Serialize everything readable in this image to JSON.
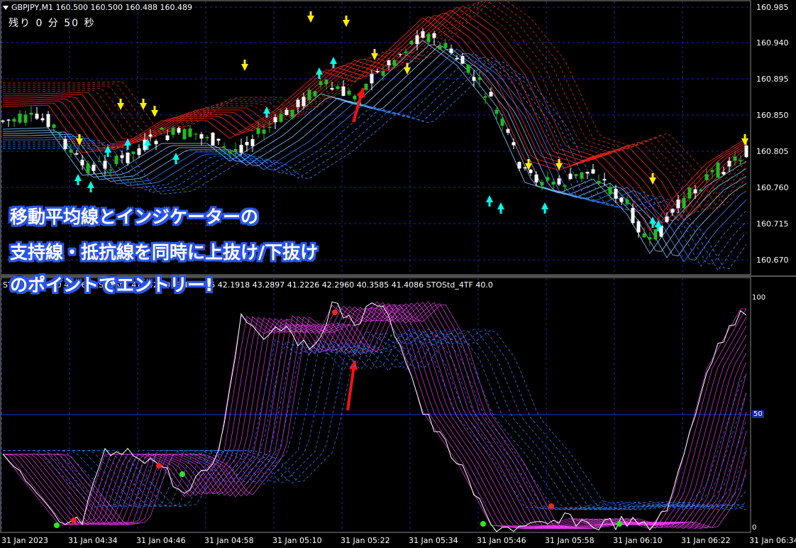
{
  "header": {
    "title": "GBPJPY,M1  160.500 160.500 160.488 160.489",
    "countdown": "残り  0 分 50 秒"
  },
  "overlay": {
    "line1": "移動平均線とインジケーターの",
    "line2": "支持線・抵抗線を同時に上抜け/下抜け",
    "line3": "のポイントでエントリー!"
  },
  "subwindow": {
    "label": "STOSt                                    42.2710 45.9611   STOStd_4TF 42.4006 44.4865 42.1918 43.2897 41.2226 42.2960 40.3585 41.4086   STOStd_4TF 40.0",
    "level_top": "100",
    "level_mid": "50",
    "level_bottom": "0"
  },
  "price_axis": [
    "160.985",
    "160.940",
    "160.895",
    "160.850",
    "160.805",
    "160.760",
    "160.715",
    "160.670"
  ],
  "time_axis": [
    "31 Jan 2023",
    "31 Jan 04:34",
    "31 Jan 04:46",
    "31 Jan 04:58",
    "31 Jan 05:10",
    "31 Jan 05:22",
    "31 Jan 05:34",
    "31 Jan 05:46",
    "31 Jan 05:58",
    "31 Jan 06:10",
    "31 Jan 06:22",
    "31 Jan 06:34"
  ],
  "colors": {
    "bull": "#22bb22",
    "bear": "#ffffff",
    "ema_fast": "#ff2020",
    "ema_slow": "#3080ff",
    "stoch_fast": "#ff40ff",
    "stoch_slow": "#2f7fff",
    "down_arrow": "#ffee00",
    "up_arrow": "#00ffee",
    "entry_arrow": "#ff1010",
    "grid": "#1a2aa0"
  },
  "icons": [
    "buy-arrow-icon",
    "sell-arrow-icon",
    "entry-arrow-icon",
    "dropdown-triangle-icon"
  ]
}
